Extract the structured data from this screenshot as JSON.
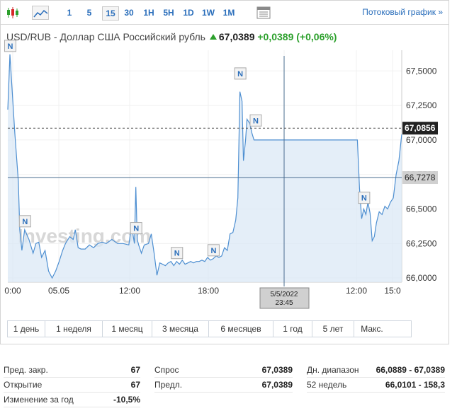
{
  "toolbar": {
    "intervals": [
      "1",
      "5",
      "15",
      "30",
      "1H",
      "5H",
      "1D",
      "1W",
      "1M"
    ],
    "active_interval": "15",
    "streaming_link": "Потоковый график »"
  },
  "header": {
    "pair": "USD/RUB - Доллар США Российский рубль",
    "price": "67,0389",
    "change": "+0,0389",
    "change_pct": "(+0,06%)",
    "up_color": "#2ca02c"
  },
  "chart_data": {
    "type": "area",
    "y_ticks": [
      "67,5000",
      "67,2500",
      "67,0000",
      "66,7500",
      "66,5000",
      "66,2500",
      "66,0000"
    ],
    "x_ticks": [
      "0:00",
      "05.05",
      "12:00",
      "18:00",
      "0:00",
      "12:00",
      "15:0"
    ],
    "ylim": [
      65.97,
      67.65
    ],
    "current_price_label": "67,0856",
    "crosshair_price_label": "66,7278",
    "crosshair_time_label": [
      "5/5/2022",
      "23:45"
    ],
    "watermark": "Investing.com",
    "news_marker": "N",
    "series_points": [
      [
        0,
        67.22
      ],
      [
        3,
        67.62
      ],
      [
        10,
        67.05
      ],
      [
        15,
        66.7
      ],
      [
        17,
        66.35
      ],
      [
        20,
        66.2
      ],
      [
        24,
        66.35
      ],
      [
        30,
        66.28
      ],
      [
        36,
        66.18
      ],
      [
        40,
        66.25
      ],
      [
        44,
        66.26
      ],
      [
        48,
        66.15
      ],
      [
        53,
        66.2
      ],
      [
        58,
        66.05
      ],
      [
        63,
        66.0
      ],
      [
        68,
        66.05
      ],
      [
        73,
        66.12
      ],
      [
        78,
        66.2
      ],
      [
        82,
        66.25
      ],
      [
        88,
        66.3
      ],
      [
        93,
        66.28
      ],
      [
        96,
        66.35
      ],
      [
        100,
        66.22
      ],
      [
        104,
        66.21
      ],
      [
        110,
        66.21
      ],
      [
        116,
        66.24
      ],
      [
        122,
        66.22
      ],
      [
        128,
        66.25
      ],
      [
        134,
        66.26
      ],
      [
        140,
        66.25
      ],
      [
        148,
        66.28
      ],
      [
        156,
        66.25
      ],
      [
        164,
        66.25
      ],
      [
        172,
        66.24
      ],
      [
        176,
        66.38
      ],
      [
        180,
        66.25
      ],
      [
        182,
        66.66
      ],
      [
        184,
        66.28
      ],
      [
        186,
        66.24
      ],
      [
        190,
        66.18
      ],
      [
        194,
        66.24
      ],
      [
        200,
        66.25
      ],
      [
        204,
        66.32
      ],
      [
        208,
        66.18
      ],
      [
        212,
        66.02
      ],
      [
        216,
        66.11
      ],
      [
        220,
        66.1
      ],
      [
        224,
        66.09
      ],
      [
        228,
        66.11
      ],
      [
        232,
        66.12
      ],
      [
        236,
        66.09
      ],
      [
        240,
        66.12
      ],
      [
        244,
        66.1
      ],
      [
        248,
        66.13
      ],
      [
        252,
        66.1
      ],
      [
        256,
        66.11
      ],
      [
        260,
        66.12
      ],
      [
        264,
        66.11
      ],
      [
        268,
        66.12
      ],
      [
        272,
        66.12
      ],
      [
        276,
        66.13
      ],
      [
        280,
        66.12
      ],
      [
        284,
        66.15
      ],
      [
        288,
        66.13
      ],
      [
        292,
        66.14
      ],
      [
        296,
        66.16
      ],
      [
        300,
        66.15
      ],
      [
        304,
        66.16
      ],
      [
        308,
        66.22
      ],
      [
        312,
        66.2
      ],
      [
        316,
        66.32
      ],
      [
        320,
        66.33
      ],
      [
        324,
        66.42
      ],
      [
        327,
        66.58
      ],
      [
        330,
        67.35
      ],
      [
        333,
        67.28
      ],
      [
        335,
        66.85
      ],
      [
        338,
        67.0
      ],
      [
        340,
        67.15
      ],
      [
        344,
        67.12
      ],
      [
        347,
        67.05
      ],
      [
        350,
        67.0
      ],
      [
        400,
        67.0
      ],
      [
        450,
        67.0
      ],
      [
        497,
        67.0
      ],
      [
        500,
        66.65
      ],
      [
        503,
        66.43
      ],
      [
        506,
        66.5
      ],
      [
        509,
        66.46
      ],
      [
        512,
        66.55
      ],
      [
        515,
        66.47
      ],
      [
        518,
        66.27
      ],
      [
        521,
        66.3
      ],
      [
        524,
        66.4
      ],
      [
        528,
        66.48
      ],
      [
        532,
        66.46
      ],
      [
        536,
        66.52
      ],
      [
        540,
        66.5
      ],
      [
        544,
        66.55
      ],
      [
        548,
        66.58
      ],
      [
        552,
        66.75
      ],
      [
        556,
        66.85
      ],
      [
        560,
        67.04
      ]
    ]
  },
  "periods": [
    "1 день",
    "1 неделя",
    "1 месяц",
    "3 месяца",
    "6 месяцев",
    "1 год",
    "5 лет",
    "Макс."
  ],
  "stats": {
    "col1": [
      {
        "label": "Пред. закр.",
        "value": "67"
      },
      {
        "label": "Открытие",
        "value": "67"
      },
      {
        "label": "Изменение за год",
        "value": "-10,5%"
      }
    ],
    "col2": [
      {
        "label": "Спрос",
        "value": "67,0389"
      },
      {
        "label": "Предл.",
        "value": "67,0389"
      }
    ],
    "col3": [
      {
        "label": "Дн. диапазон",
        "value": "66,0889 - 67,0389"
      },
      {
        "label": "52 недель",
        "value": "66,0101 - 158,3"
      }
    ]
  }
}
